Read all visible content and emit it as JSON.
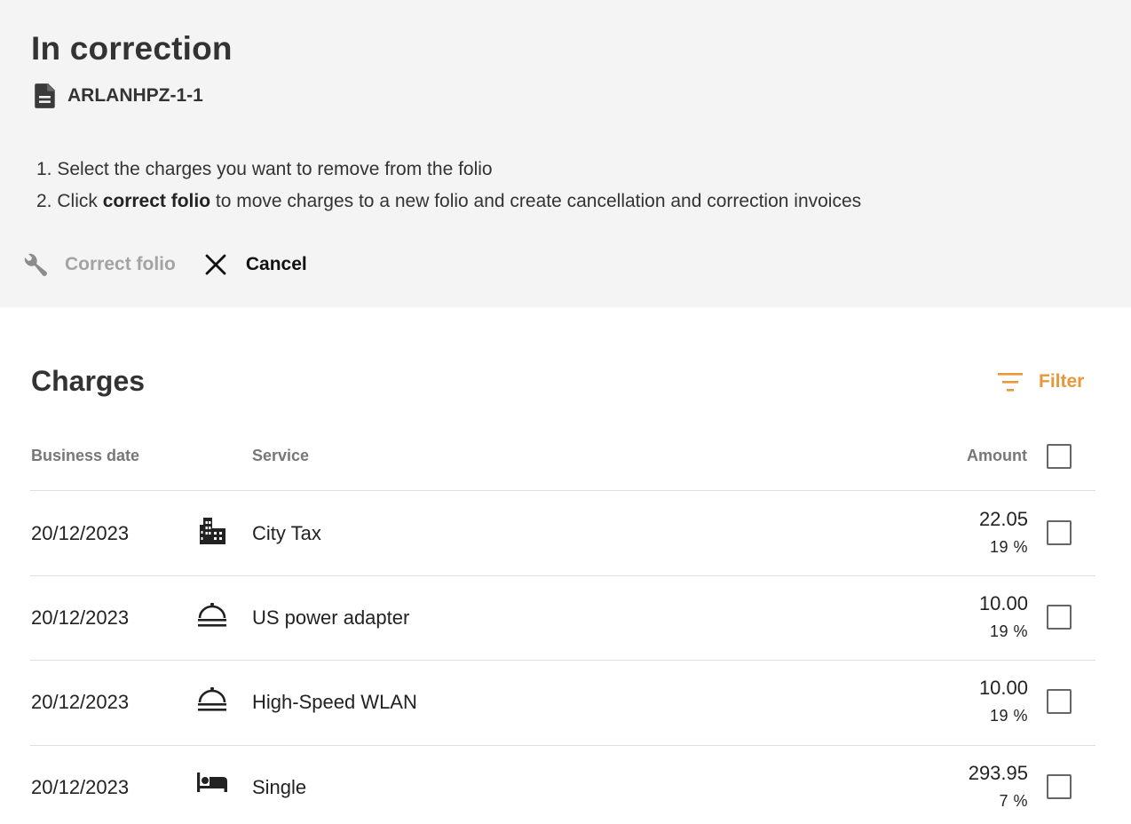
{
  "header": {
    "title": "In correction",
    "folio_id": "ARLANHPZ-1-1",
    "steps": [
      {
        "number": "1.",
        "text": "Select the charges you want to remove from the folio"
      },
      {
        "number": "2.",
        "pre": "Click ",
        "bold": "correct folio",
        "post": " to move charges to a new folio and create cancellation and correction invoices"
      }
    ]
  },
  "actions": {
    "correct_label": "Correct folio",
    "cancel_label": "Cancel"
  },
  "charges": {
    "title": "Charges",
    "filter_label": "Filter",
    "columns": {
      "date": "Business date",
      "service": "Service",
      "amount": "Amount"
    },
    "rows": [
      {
        "date": "20/12/2023",
        "icon": "city-icon",
        "service": "City Tax",
        "amount": "22.05",
        "vat": "19 %"
      },
      {
        "date": "20/12/2023",
        "icon": "room-service-icon",
        "service": "US power adapter",
        "amount": "10.00",
        "vat": "19 %"
      },
      {
        "date": "20/12/2023",
        "icon": "room-service-icon",
        "service": "High-Speed WLAN",
        "amount": "10.00",
        "vat": "19 %"
      },
      {
        "date": "20/12/2023",
        "icon": "bed-icon",
        "service": "Single",
        "amount": "293.95",
        "vat": "7 %"
      }
    ]
  },
  "colors": {
    "panel_bg": "#f4f4f4",
    "accent": "#e8983a",
    "disabled_text": "#a3a3a3"
  }
}
